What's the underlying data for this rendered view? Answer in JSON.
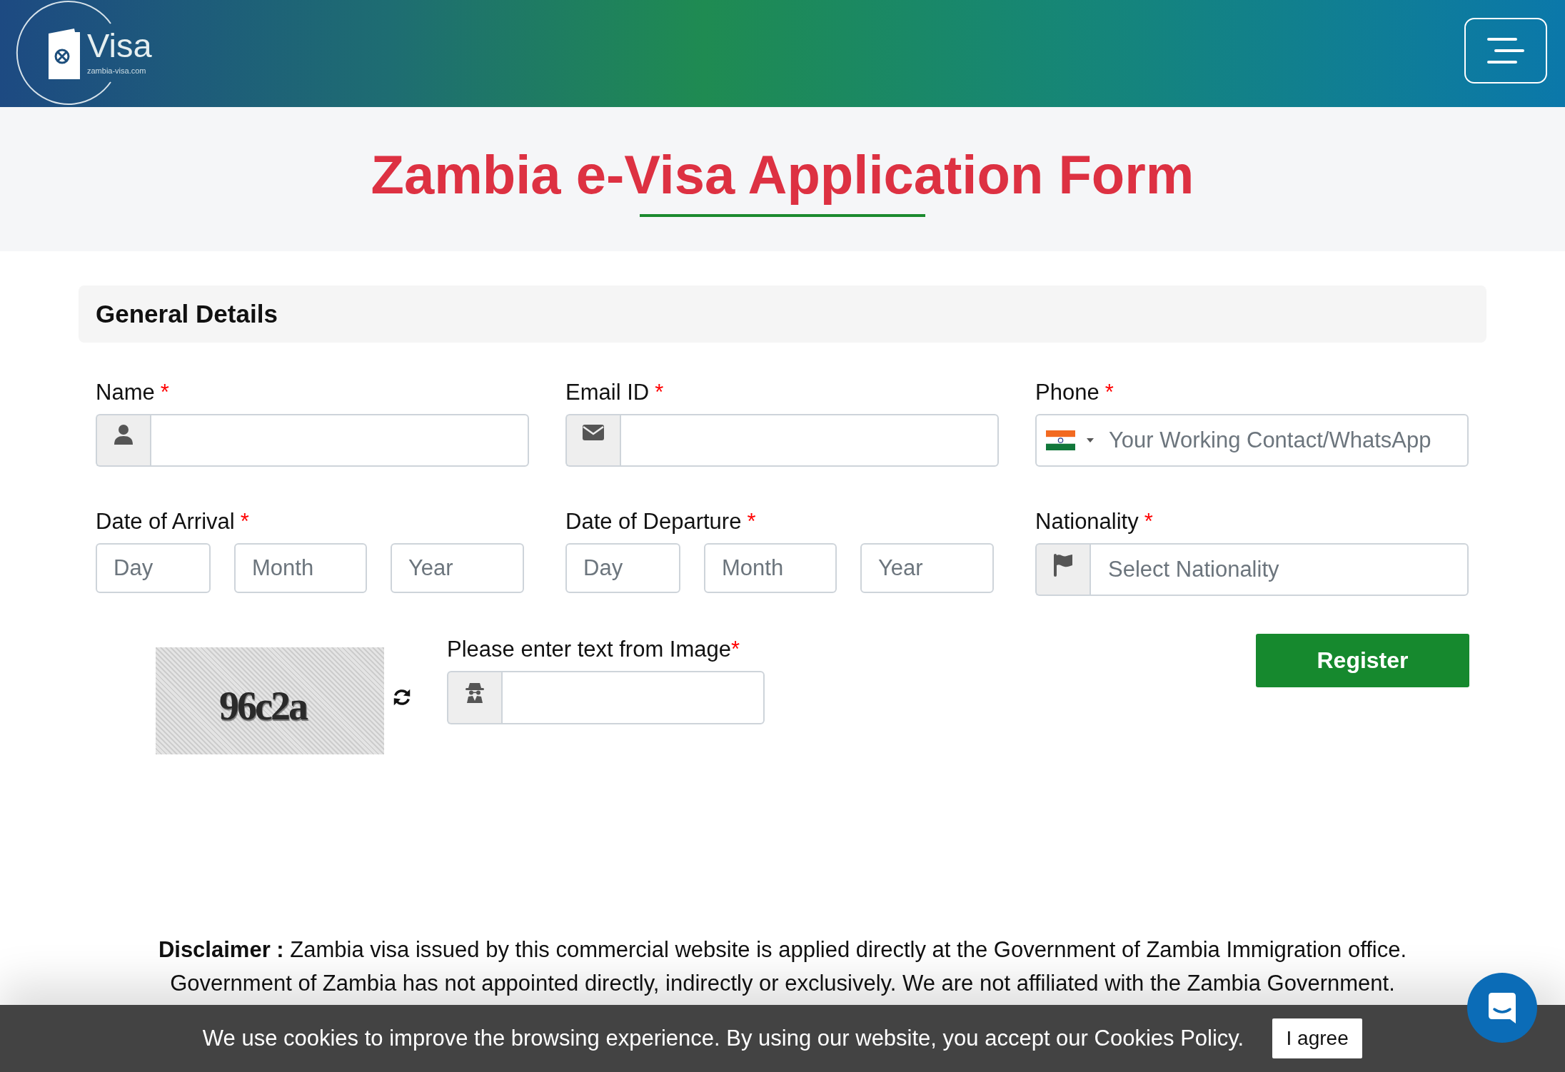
{
  "header": {
    "logo_text": "Visa",
    "logo_domain": "zambia-visa.com"
  },
  "page_title": "Zambia e-Visa Application Form",
  "section": {
    "title": "General Details"
  },
  "fields": [
    {
      "kind": "name",
      "label": "Name",
      "required_mark": "*"
    },
    {
      "kind": "email",
      "label": "Email ID",
      "required_mark": "*"
    },
    {
      "kind": "phone",
      "label": "Phone",
      "required_mark": "*",
      "placeholder": "Your Working Contact/WhatsApp"
    },
    {
      "kind": "date",
      "label": "Date of Arrival",
      "required_mark": "*",
      "parts": [
        {
          "placeholder": "Day"
        },
        {
          "placeholder": "Month"
        },
        {
          "placeholder": "Year"
        }
      ]
    },
    {
      "kind": "date",
      "label": "Date of Departure",
      "required_mark": "*",
      "parts": [
        {
          "placeholder": "Day"
        },
        {
          "placeholder": "Month"
        },
        {
          "placeholder": "Year"
        }
      ]
    },
    {
      "kind": "nationality",
      "label": "Nationality",
      "required_mark": "*",
      "placeholder": "Select Nationality"
    }
  ],
  "captcha": {
    "image_text": "96c2a",
    "label": "Please enter text from Image",
    "required_mark": "*"
  },
  "submit_button": "Register",
  "disclaimer": "**Disclaimer :** Zambia visa issued by this commercial website is applied directly at the Government of Zambia Immigration office. Government of Zambia has not appointed directly, indirectly or exclusively. We are not affiliated with the Zambia Government.",
  "cookie_banner": {
    "message": "We use cookies to improve the browsing experience. By using our website, you accept our Cookies Policy.",
    "button": "I agree"
  }
}
